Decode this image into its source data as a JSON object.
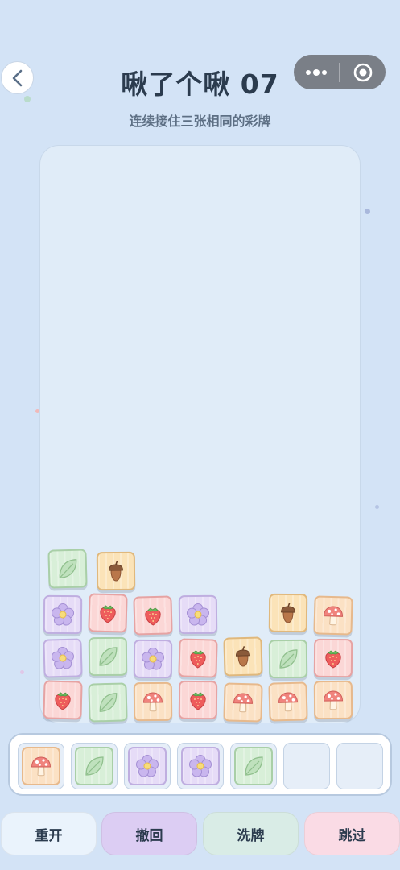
{
  "header": {
    "title": "啾了个啾 07",
    "subtitle": "连续接住三张相同的彩牌"
  },
  "board": {
    "tiles": [
      {
        "type": "leaf",
        "row": 0,
        "col": 0
      },
      {
        "type": "acorn",
        "row": 0,
        "col": 1
      },
      {
        "type": "flower",
        "row": 1,
        "col": 0
      },
      {
        "type": "strawberry",
        "row": 1,
        "col": 1
      },
      {
        "type": "strawberry",
        "row": 1,
        "col": 2
      },
      {
        "type": "flower",
        "row": 1,
        "col": 3
      },
      {
        "type": "acorn",
        "row": 1,
        "col": 5
      },
      {
        "type": "mushroom",
        "row": 1,
        "col": 6
      },
      {
        "type": "flower",
        "row": 2,
        "col": 0
      },
      {
        "type": "leaf",
        "row": 2,
        "col": 1
      },
      {
        "type": "flower",
        "row": 2,
        "col": 2
      },
      {
        "type": "strawberry",
        "row": 2,
        "col": 3
      },
      {
        "type": "acorn",
        "row": 2,
        "col": 4
      },
      {
        "type": "leaf",
        "row": 2,
        "col": 5
      },
      {
        "type": "strawberry",
        "row": 2,
        "col": 6
      },
      {
        "type": "strawberry",
        "row": 3,
        "col": 0
      },
      {
        "type": "leaf",
        "row": 3,
        "col": 1
      },
      {
        "type": "mushroom",
        "row": 3,
        "col": 2
      },
      {
        "type": "strawberry",
        "row": 3,
        "col": 3
      },
      {
        "type": "mushroom",
        "row": 3,
        "col": 4
      },
      {
        "type": "mushroom",
        "row": 3,
        "col": 5
      },
      {
        "type": "mushroom",
        "row": 3,
        "col": 6
      }
    ]
  },
  "tray": {
    "slots": [
      "mushroom",
      "leaf",
      "flower",
      "flower",
      "leaf",
      null,
      null
    ]
  },
  "actions": {
    "restart_label": "重开",
    "undo_label": "撤回",
    "shuffle_label": "洗牌",
    "skip_label": "跳过"
  },
  "colors": {
    "restart_bg": "#eaf3fc",
    "undo_bg": "#dccdf3",
    "shuffle_bg": "#d9ece6",
    "skip_bg": "#fadbe5"
  }
}
